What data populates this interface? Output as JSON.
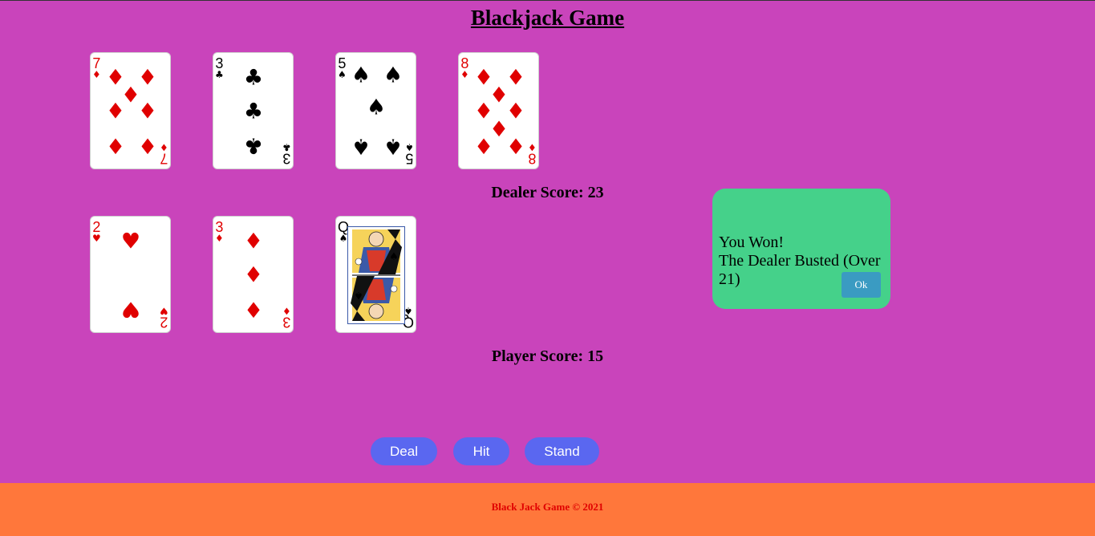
{
  "title": "Blackjack Game",
  "dealer": {
    "score_label": "Dealer Score: 23",
    "cards": [
      {
        "rank": "7",
        "suit_symbol": "♦",
        "suit": "diamonds",
        "color": "red"
      },
      {
        "rank": "3",
        "suit_symbol": "♣",
        "suit": "clubs",
        "color": "black"
      },
      {
        "rank": "5",
        "suit_symbol": "♠",
        "suit": "spades",
        "color": "black"
      },
      {
        "rank": "8",
        "suit_symbol": "♦",
        "suit": "diamonds",
        "color": "red"
      }
    ]
  },
  "player": {
    "score_label": "Player Score: 15",
    "cards": [
      {
        "rank": "2",
        "suit_symbol": "♥",
        "suit": "hearts",
        "color": "red"
      },
      {
        "rank": "3",
        "suit_symbol": "♦",
        "suit": "diamonds",
        "color": "red"
      },
      {
        "rank": "Q",
        "suit_symbol": "♠",
        "suit": "spades",
        "color": "black",
        "face_card": "queen-of-spades"
      }
    ]
  },
  "popup": {
    "line1": "You Won!",
    "line2": "The Dealer Busted (Over 21)",
    "ok_label": "Ok",
    "background": "#45d18a"
  },
  "controls": {
    "deal_label": "Deal",
    "hit_label": "Hit",
    "stand_label": "Stand",
    "button_color": "#5a67f0"
  },
  "footer": {
    "text": "Black Jack Game © 2021",
    "background": "#ff773b"
  },
  "colors": {
    "page_background": "#c944bb",
    "red_suit": "#e00000"
  }
}
